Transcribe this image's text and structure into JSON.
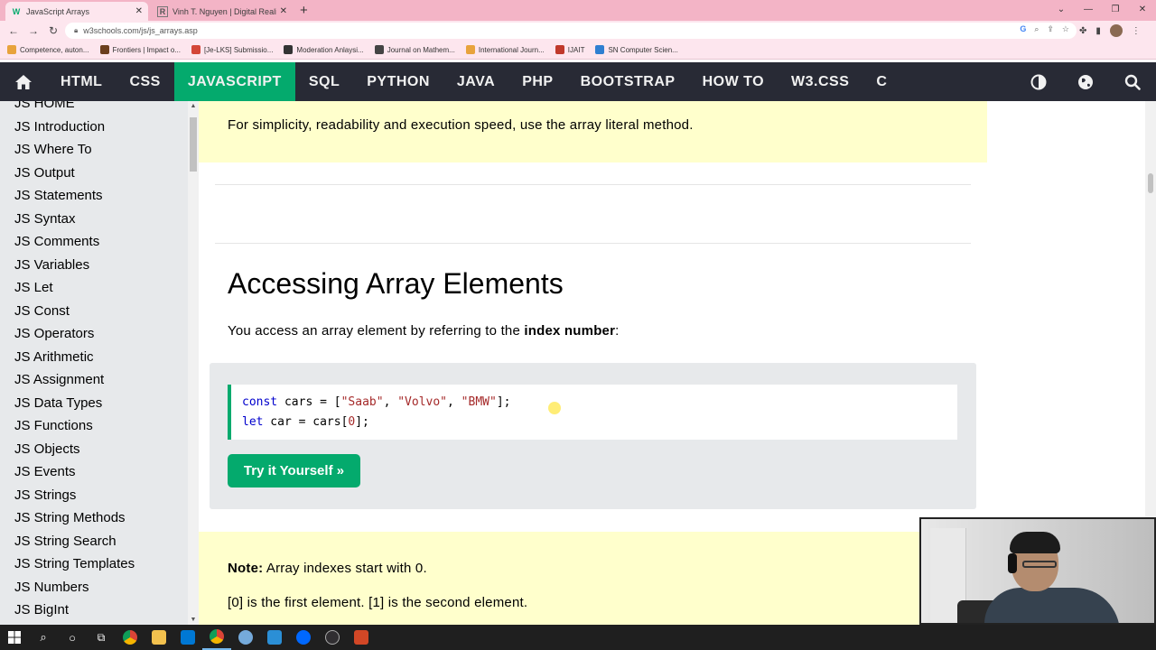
{
  "browser": {
    "tabs": [
      {
        "title": "JavaScript Arrays",
        "favicon": "W",
        "active": true
      },
      {
        "title": "Vinh T. Nguyen | Digital Reality",
        "favicon": "R",
        "active": false
      }
    ],
    "url": "w3schools.com/js/js_arrays.asp",
    "bookmarks": [
      {
        "label": "Competence, auton...",
        "color": "#e8a33c"
      },
      {
        "label": "Frontiers | Impact o...",
        "color": "#6b3f1e"
      },
      {
        "label": "[Je-LKS] Submissio...",
        "color": "#d44638"
      },
      {
        "label": "Moderation Anlaysi...",
        "color": "#333333"
      },
      {
        "label": "Journal on Mathem...",
        "color": "#444444"
      },
      {
        "label": "International Journ...",
        "color": "#e8a33c"
      },
      {
        "label": "IJAIT",
        "color": "#c0392b"
      },
      {
        "label": "SN Computer Scien...",
        "color": "#2f7fd1"
      }
    ]
  },
  "topnav": {
    "items": [
      "HTML",
      "CSS",
      "JAVASCRIPT",
      "SQL",
      "PYTHON",
      "JAVA",
      "PHP",
      "BOOTSTRAP",
      "HOW TO",
      "W3.CSS",
      "C"
    ],
    "active": "JAVASCRIPT"
  },
  "sidebar": {
    "items": [
      "JS HOME",
      "JS Introduction",
      "JS Where To",
      "JS Output",
      "JS Statements",
      "JS Syntax",
      "JS Comments",
      "JS Variables",
      "JS Let",
      "JS Const",
      "JS Operators",
      "JS Arithmetic",
      "JS Assignment",
      "JS Data Types",
      "JS Functions",
      "JS Objects",
      "JS Events",
      "JS Strings",
      "JS String Methods",
      "JS String Search",
      "JS String Templates",
      "JS Numbers",
      "JS BigInt"
    ]
  },
  "main": {
    "tip": "For simplicity, readability and execution speed, use the array literal method.",
    "heading": "Accessing Array Elements",
    "intro_pre": "You access an array element by referring to the ",
    "intro_bold": "index number",
    "intro_post": ":",
    "code": {
      "line1_kw": "const",
      "line1_var": " cars = [",
      "line1_s1": "\"Saab\"",
      "line1_c1": ", ",
      "line1_s2": "\"Volvo\"",
      "line1_c2": ", ",
      "line1_s3": "\"BMW\"",
      "line1_end": "];",
      "line2_kw": "let",
      "line2_var": " car = cars[",
      "line2_num": "0",
      "line2_end": "];"
    },
    "try_button": "Try it Yourself »",
    "note_label": "Note:",
    "note_text": " Array indexes start with 0.",
    "note_line2": "[0] is the first element. [1] is the second element."
  },
  "colors": {
    "nav_bg": "#282a35",
    "accent": "#04aa6d",
    "note_bg": "#ffffcc",
    "sidebar_bg": "#e7e9eb"
  }
}
